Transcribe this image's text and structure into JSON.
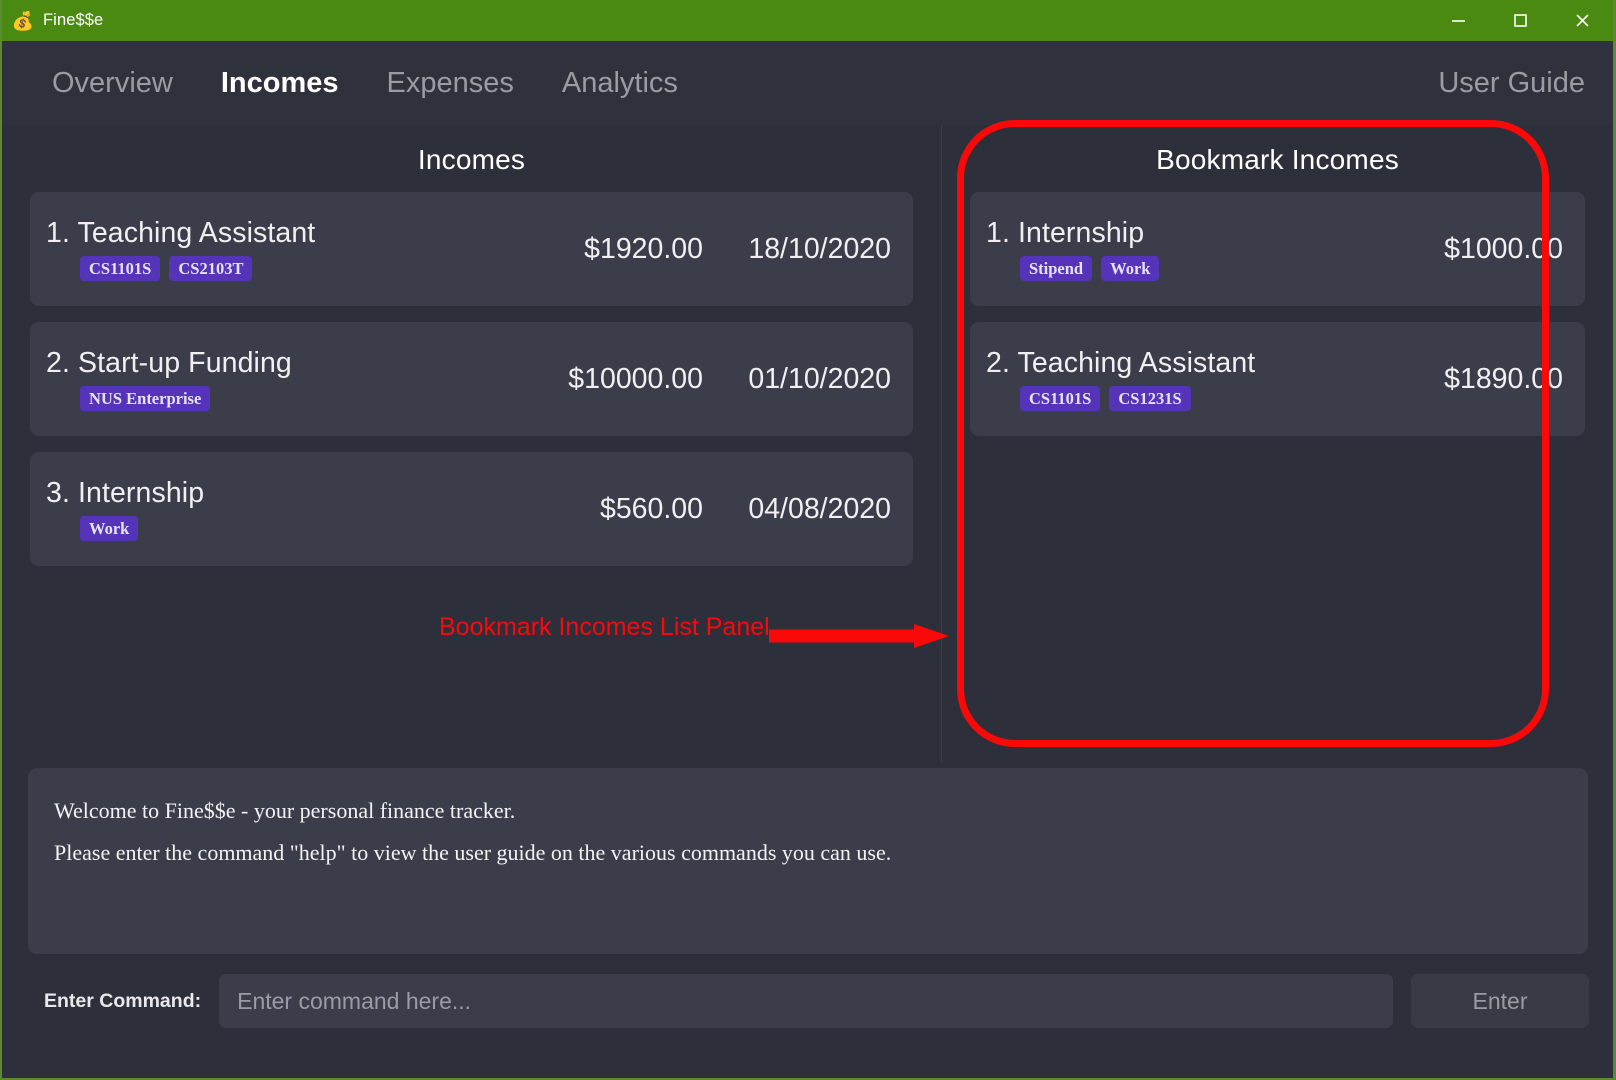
{
  "window": {
    "title": "Fine$$e",
    "icon": "money-bag-icon",
    "accent_green": "#4b8a10",
    "minimize": "─",
    "maximize": "□",
    "close": "✕"
  },
  "nav": {
    "tabs": [
      {
        "label": "Overview",
        "active": false
      },
      {
        "label": "Incomes",
        "active": true
      },
      {
        "label": "Expenses",
        "active": false
      },
      {
        "label": "Analytics",
        "active": false
      }
    ],
    "user_guide": "User Guide"
  },
  "incomes_panel": {
    "title": "Incomes",
    "items": [
      {
        "index": "1.",
        "name": "Teaching Assistant",
        "title": "1. Teaching Assistant",
        "amount": "$1920.00",
        "date": "18/10/2020",
        "tags": [
          "CS1101S",
          "CS2103T"
        ]
      },
      {
        "index": "2.",
        "name": "Start-up Funding",
        "title": "2. Start-up Funding",
        "amount": "$10000.00",
        "date": "01/10/2020",
        "tags": [
          "NUS Enterprise"
        ]
      },
      {
        "index": "3.",
        "name": "Internship",
        "title": "3. Internship",
        "amount": "$560.00",
        "date": "04/08/2020",
        "tags": [
          "Work"
        ]
      }
    ]
  },
  "bookmark_panel": {
    "title": "Bookmark Incomes",
    "items": [
      {
        "index": "1.",
        "name": "Internship",
        "title": "1. Internship",
        "amount": "$1000.00",
        "tags": [
          "Stipend",
          "Work"
        ]
      },
      {
        "index": "2.",
        "name": "Teaching Assistant",
        "title": "2. Teaching Assistant",
        "amount": "$1890.00",
        "tags": [
          "CS1101S",
          "CS1231S"
        ]
      }
    ]
  },
  "result_box": {
    "lines": [
      "Welcome to Fine$$e - your personal finance tracker.",
      "Please enter the command \"help\" to view the user guide on the various commands you can use."
    ]
  },
  "command_bar": {
    "label": "Enter Command:",
    "placeholder": "Enter command here...",
    "value": "",
    "enter_label": "Enter"
  },
  "annotation": {
    "label": "Bookmark Incomes List Panel",
    "color": "#fb0808",
    "target": "bookmark-incomes-list-panel"
  },
  "colors": {
    "titlebar": "#4b8a10",
    "page_bg": "#2d303b",
    "nav_bg": "#2f323d",
    "card_bg": "#3b3e4a",
    "tag_bg": "#5534ba",
    "text": "#f0f0f2",
    "muted": "#9a9ca4"
  }
}
